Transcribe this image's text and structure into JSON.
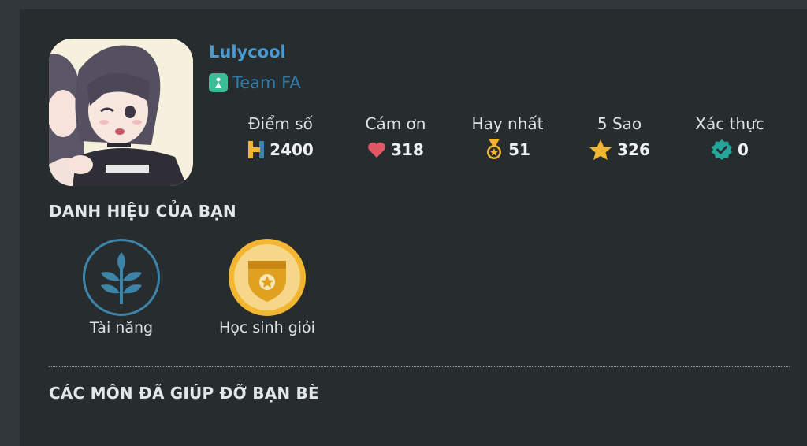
{
  "profile": {
    "username": "Lulycool",
    "team": "Team FA"
  },
  "stats": [
    {
      "label": "Điểm số",
      "value": "2400",
      "icon": "h-logo-icon",
      "color": "#f2b632"
    },
    {
      "label": "Cám ơn",
      "value": "318",
      "icon": "heart-icon",
      "color": "#e15764"
    },
    {
      "label": "Hay nhất",
      "value": "51",
      "icon": "medal-icon",
      "color": "#f2b632"
    },
    {
      "label": "5 Sao",
      "value": "326",
      "icon": "star-icon",
      "color": "#f2b632"
    },
    {
      "label": "Xác thực",
      "value": "0",
      "icon": "verified-check-icon",
      "color": "#26a69a"
    }
  ],
  "titles_section": {
    "heading": "DANH HIỆU CỦA BẠN",
    "badges": [
      {
        "label": "Tài năng",
        "icon": "leaf-icon",
        "color": "#3d84a8"
      },
      {
        "label": "Học sinh giỏi",
        "icon": "shield-star-icon",
        "color": "#f2b632"
      }
    ]
  },
  "subjects_section": {
    "heading": "CÁC MÔN ĐÃ GIÚP ĐỠ BẠN BÈ"
  }
}
